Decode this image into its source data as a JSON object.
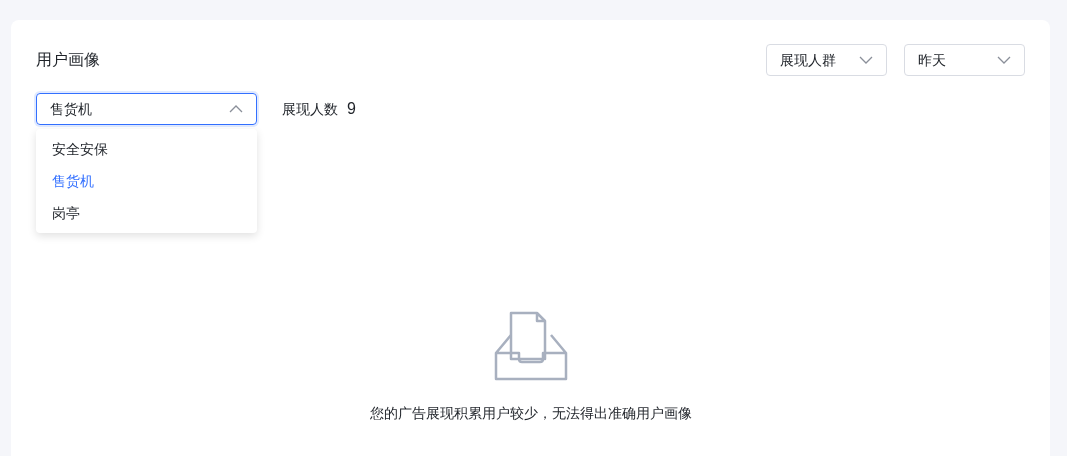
{
  "card": {
    "title": "用户画像",
    "filters": [
      {
        "value": "展现人群"
      },
      {
        "value": "昨天"
      }
    ],
    "category_select": {
      "value": "售货机",
      "expanded": true,
      "options": [
        {
          "label": "安全安保",
          "selected": false
        },
        {
          "label": "售货机",
          "selected": true
        },
        {
          "label": "岗亭",
          "selected": false
        }
      ]
    },
    "stat": {
      "label": "展现人数",
      "value": "9"
    },
    "empty_state": {
      "message": "您的广告展现积累用户较少，无法得出准确用户画像"
    }
  }
}
